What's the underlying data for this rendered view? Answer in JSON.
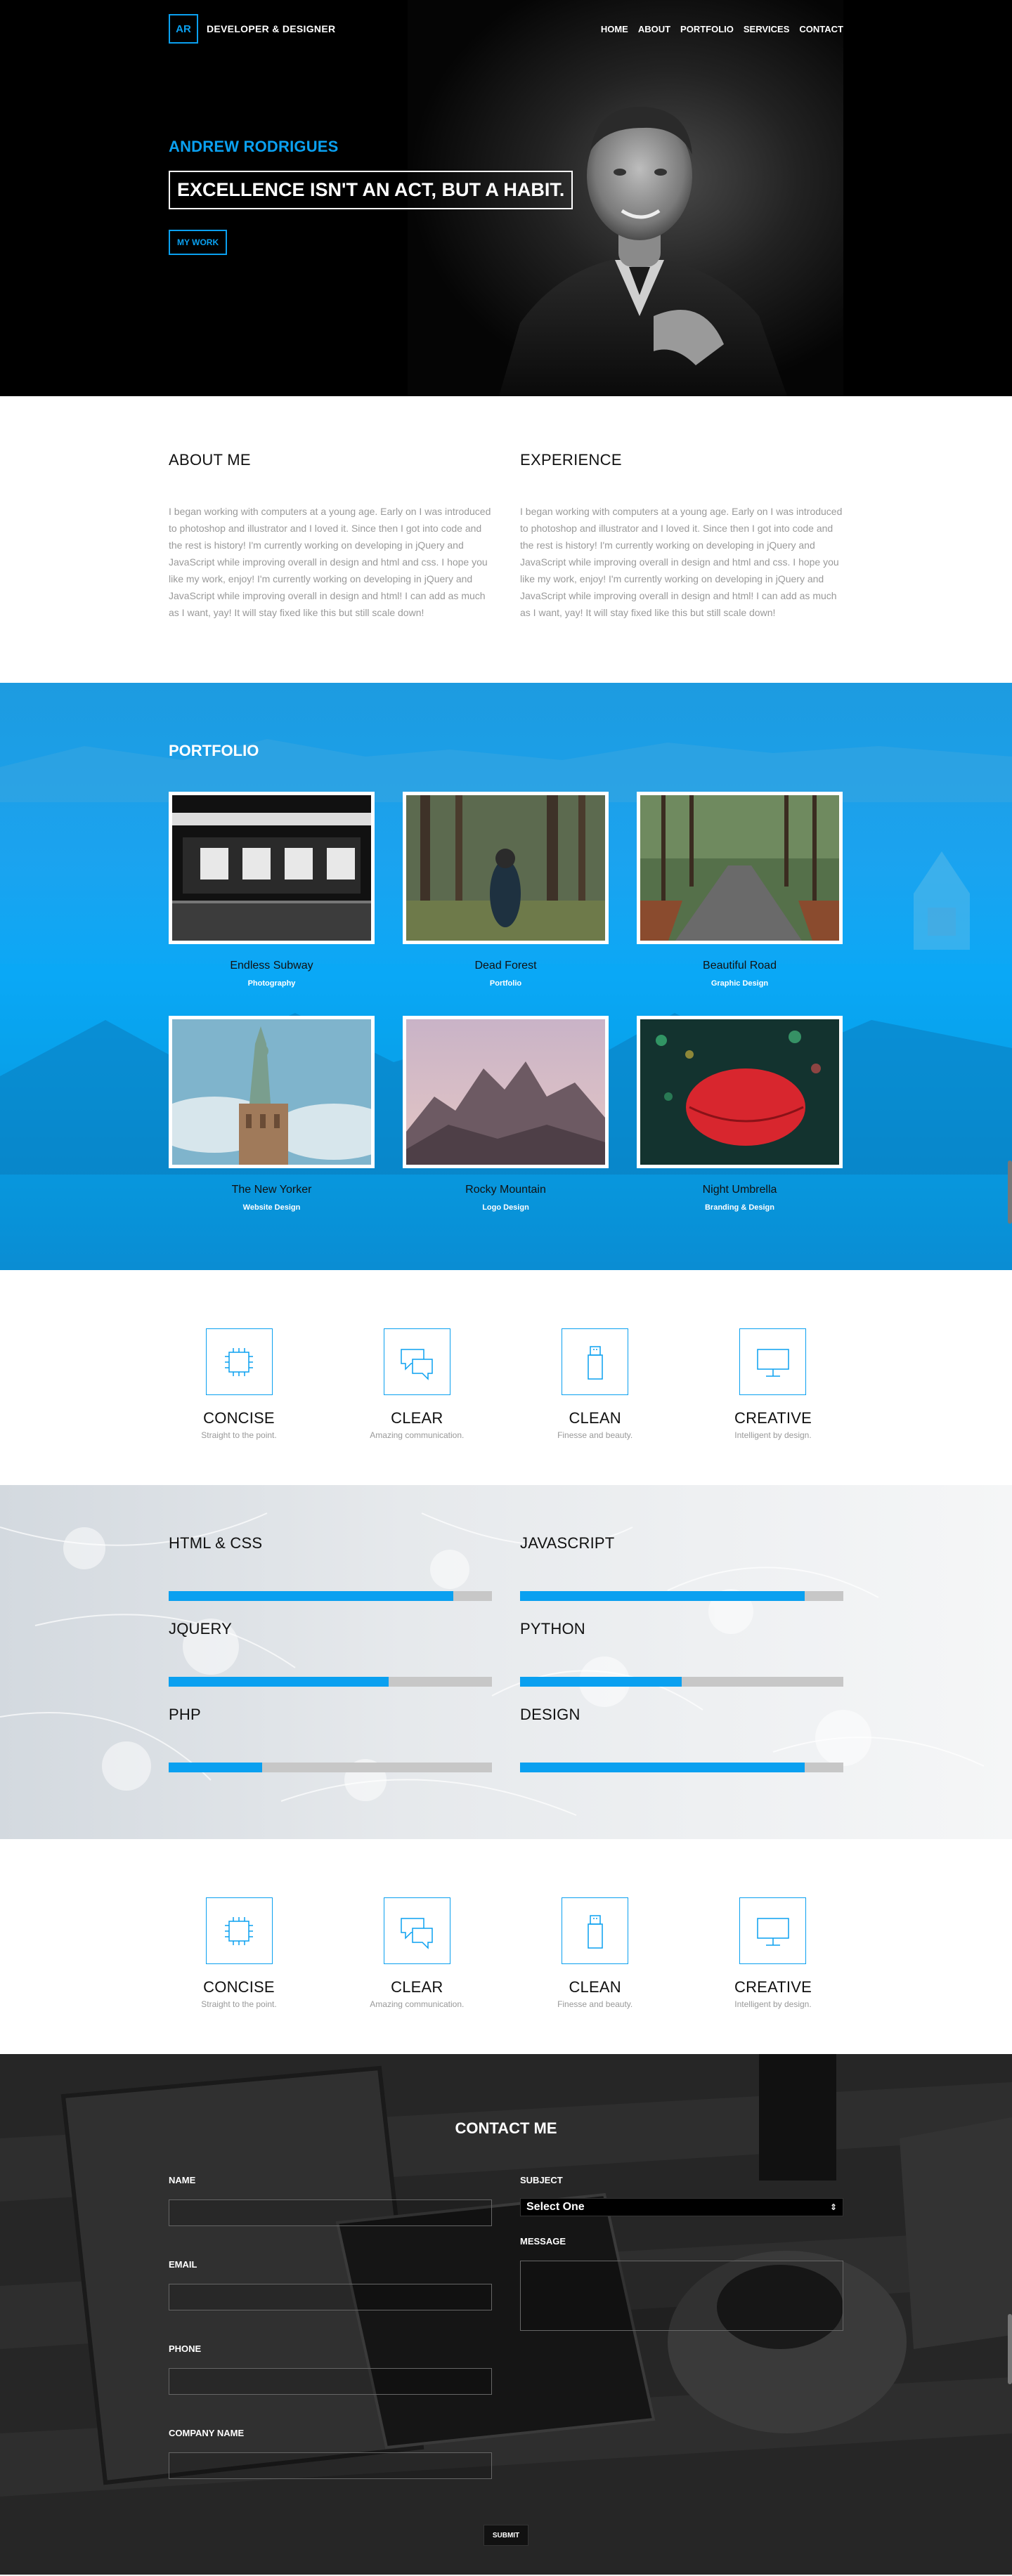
{
  "nav": {
    "logo": "AR",
    "title": "DEVELOPER & DESIGNER",
    "links": [
      "HOME",
      "ABOUT",
      "PORTFOLIO",
      "SERVICES",
      "CONTACT"
    ]
  },
  "hero": {
    "name": "ANDREW RODRIGUES",
    "tagline": "EXCELLENCE ISN'T AN ACT, BUT A HABIT.",
    "button": "MY WORK"
  },
  "about": {
    "left_title": "ABOUT ME",
    "left_text": "I began working with computers at a young age. Early on I was introduced to photoshop and illustrator and I loved it. Since then I got into code and the rest is history! I'm currently working on developing in jQuery and JavaScript while improving overall in design and html and css. I hope you like my work, enjoy! I'm currently working on developing in jQuery and JavaScript while improving overall in design and html! I can add as much as I want, yay! It will stay fixed like this but still scale down!",
    "right_title": "EXPERIENCE",
    "right_text": "I began working with computers at a young age. Early on I was introduced to photoshop and illustrator and I loved it. Since then I got into code and the rest is history! I'm currently working on developing in jQuery and JavaScript while improving overall in design and html and css. I hope you like my work, enjoy! I'm currently working on developing in jQuery and JavaScript while improving overall in design and html! I can add as much as I want, yay! It will stay fixed like this but still scale down!"
  },
  "portfolio": {
    "title": "PORTFOLIO",
    "items": [
      {
        "title": "Endless Subway",
        "category": "Photography"
      },
      {
        "title": "Dead Forest",
        "category": "Portfolio"
      },
      {
        "title": "Beautiful Road",
        "category": "Graphic Design"
      },
      {
        "title": "The New Yorker",
        "category": "Website Design"
      },
      {
        "title": "Rocky Mountain",
        "category": "Logo Design"
      },
      {
        "title": "Night Umbrella",
        "category": "Branding & Design"
      }
    ]
  },
  "features": [
    {
      "title": "CONCISE",
      "subtitle": "Straight to the point.",
      "icon": "chip-icon"
    },
    {
      "title": "CLEAR",
      "subtitle": "Amazing communication.",
      "icon": "chat-bubbles-icon"
    },
    {
      "title": "CLEAN",
      "subtitle": "Finesse and beauty.",
      "icon": "usb-drive-icon"
    },
    {
      "title": "CREATIVE",
      "subtitle": "Intelligent by design.",
      "icon": "monitor-icon"
    }
  ],
  "skills": [
    {
      "name": "HTML & CSS",
      "level": 0.88
    },
    {
      "name": "JAVASCRIPT",
      "level": 0.88
    },
    {
      "name": "JQUERY",
      "level": 0.68
    },
    {
      "name": "PYTHON",
      "level": 0.5
    },
    {
      "name": "PHP",
      "level": 0.29
    },
    {
      "name": "DESIGN",
      "level": 0.88
    }
  ],
  "contact": {
    "title": "CONTACT ME",
    "name_label": "NAME",
    "email_label": "EMAIL",
    "phone_label": "PHONE",
    "company_label": "COMPANY NAME",
    "subject_label": "SUBJECT",
    "subject_value": "Select One",
    "message_label": "MESSAGE",
    "submit": "SUBMIT"
  },
  "colors": {
    "accent": "#0aa0f0",
    "hero_bg": "#000000",
    "portfolio_bg": "#0ba8f6"
  }
}
